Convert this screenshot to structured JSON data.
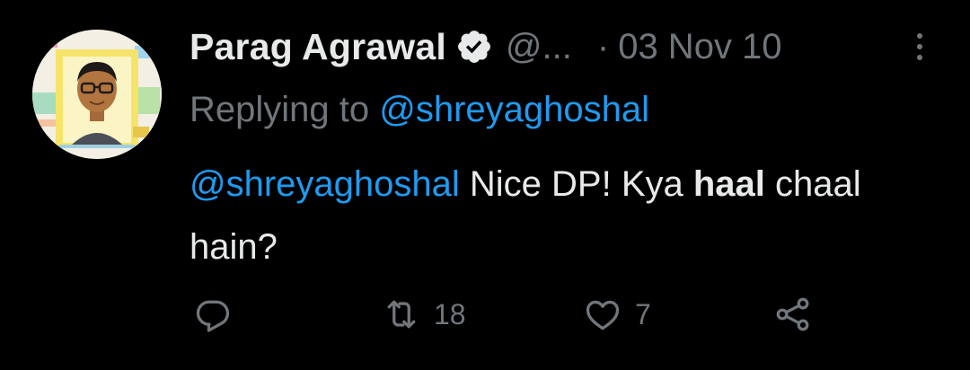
{
  "tweet": {
    "author_name": "Parag Agrawal",
    "handle": "@...",
    "separator": "·",
    "date": "03 Nov 10",
    "replying_prefix": "Replying to",
    "replying_to": "@shreyaghoshal",
    "body_mention": "@shreyaghoshal",
    "body_text_1": " Nice DP! Kya ",
    "body_bold": "haal",
    "body_text_2": " chaal hain?"
  },
  "actions": {
    "reply_count": "",
    "retweet_count": "18",
    "like_count": "7"
  },
  "icons": {
    "verified": "verified-badge-icon",
    "more": "more-vertical-icon",
    "reply": "reply-icon",
    "retweet": "retweet-icon",
    "like": "heart-icon",
    "share": "share-icon"
  },
  "colors": {
    "background": "#000000",
    "text": "#e7e9ea",
    "muted": "#71767b",
    "accent": "#1d9bf0"
  }
}
